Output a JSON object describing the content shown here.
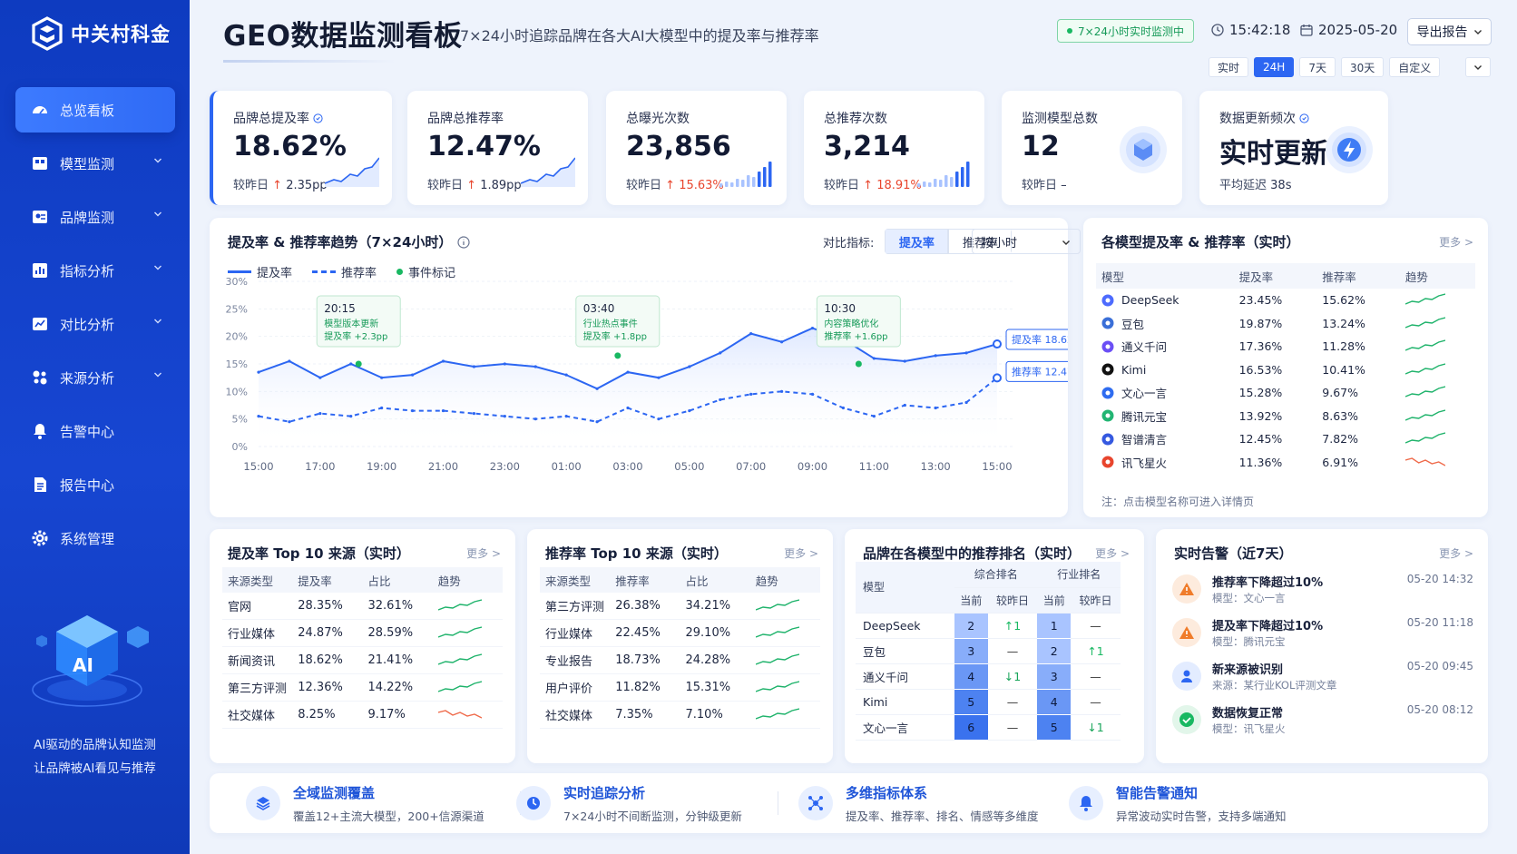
{
  "brand": {
    "name": "中关村科金"
  },
  "sidebar": {
    "items": [
      {
        "label": "总览看板",
        "icon": "dashboard-icon",
        "active": true,
        "expandable": false
      },
      {
        "label": "模型监测",
        "icon": "model-icon",
        "expandable": true
      },
      {
        "label": "品牌监测",
        "icon": "brand-icon",
        "expandable": true
      },
      {
        "label": "指标分析",
        "icon": "chart-icon",
        "expandable": true
      },
      {
        "label": "对比分析",
        "icon": "compare-icon",
        "expandable": true
      },
      {
        "label": "来源分析",
        "icon": "source-icon",
        "expandable": true
      },
      {
        "label": "告警中心",
        "icon": "bell-icon",
        "expandable": false
      },
      {
        "label": "报告中心",
        "icon": "report-icon",
        "expandable": false
      },
      {
        "label": "系统管理",
        "icon": "gear-icon",
        "expandable": false
      }
    ],
    "caption_line1": "AI驱动的品牌认知监测",
    "caption_line2": "让品牌被AI看见与推荐"
  },
  "header": {
    "title": "GEO数据监测看板",
    "subtitle": "7×24小时追踪品牌在各大AI大模型中的提及率与推荐率",
    "live_badge": "7×24小时实时监测中",
    "time": "15:42:18",
    "date": "2025-05-20",
    "export_label": "导出报告",
    "ranges": [
      "实时",
      "24H",
      "7天",
      "30天",
      "自定义"
    ],
    "active_range": "24H"
  },
  "kpis": [
    {
      "label": "品牌总提及率",
      "value": "18.62%",
      "cmp_label": "较昨日",
      "change": "2.35pp",
      "dir": "up",
      "has_info": true
    },
    {
      "label": "品牌总推荐率",
      "value": "12.47%",
      "cmp_label": "较昨日",
      "change": "1.89pp",
      "dir": "up"
    },
    {
      "label": "总曝光次数",
      "value": "23,856",
      "cmp_label": "较昨日",
      "change": "15.63%",
      "dir": "up"
    },
    {
      "label": "总推荐次数",
      "value": "3,214",
      "cmp_label": "较昨日",
      "change": "18.91%",
      "dir": "up"
    },
    {
      "label": "监测模型总数",
      "value": "12",
      "cmp_label": "较昨日",
      "change": "–",
      "dir": "flat"
    },
    {
      "label": "数据更新频次",
      "value": "实时更新",
      "cmp_label": "平均延迟",
      "change": "38s",
      "dir": "none",
      "has_info": true
    }
  ],
  "trend": {
    "title": "提及率 & 推荐率趋势（7×24小时）",
    "compare_label": "对比指标:",
    "compare_options": [
      "提及率",
      "推荐率"
    ],
    "granularity": "按小时",
    "legend": [
      "提及率",
      "推荐率",
      "事件标记"
    ],
    "annotations": [
      {
        "time": "20:15",
        "line1": "模型版本更新",
        "line2": "提及率 +2.3pp"
      },
      {
        "time": "03:40",
        "line1": "行业热点事件",
        "line2": "提及率 +1.8pp"
      },
      {
        "time": "10:30",
        "line1": "内容策略优化",
        "line2": "推荐率 +1.6pp"
      }
    ],
    "end_labels": [
      "提及率 18.62%",
      "推荐率 12.47%"
    ]
  },
  "chart_data": {
    "type": "line",
    "x": [
      "15:00",
      "16:00",
      "17:00",
      "18:00",
      "19:00",
      "20:00",
      "21:00",
      "22:00",
      "23:00",
      "00:00",
      "01:00",
      "02:00",
      "03:00",
      "04:00",
      "05:00",
      "06:00",
      "07:00",
      "08:00",
      "09:00",
      "10:00",
      "11:00",
      "12:00",
      "13:00",
      "14:00",
      "15:00"
    ],
    "x_ticks": [
      "15:00",
      "17:00",
      "19:00",
      "21:00",
      "23:00",
      "01:00",
      "03:00",
      "05:00",
      "07:00",
      "09:00",
      "11:00",
      "13:00",
      "15:00"
    ],
    "ylim": [
      0,
      30
    ],
    "y_ticks": [
      "0%",
      "5%",
      "10%",
      "15%",
      "20%",
      "25%",
      "30%"
    ],
    "series": [
      {
        "name": "提及率",
        "style": "solid",
        "color": "#2c66f2",
        "values": [
          13.5,
          15.5,
          12.5,
          15.0,
          12.5,
          13.0,
          15.5,
          14.5,
          15.0,
          14.5,
          13.0,
          10.5,
          13.5,
          12.5,
          14.5,
          17.0,
          20.5,
          19.0,
          21.5,
          19.5,
          16.0,
          15.5,
          16.5,
          17.0,
          18.62
        ]
      },
      {
        "name": "推荐率",
        "style": "dashed",
        "color": "#2c66f2",
        "values": [
          5.5,
          4.5,
          6.0,
          5.5,
          7.0,
          6.5,
          6.5,
          6.0,
          5.5,
          5.0,
          5.5,
          4.5,
          7.0,
          5.0,
          6.5,
          8.5,
          9.5,
          10.0,
          9.5,
          7.0,
          5.5,
          7.5,
          7.0,
          8.0,
          12.47
        ]
      }
    ],
    "events": [
      {
        "x": "20:15",
        "y": 15.0
      },
      {
        "x": "03:40",
        "y": 16.5
      },
      {
        "x": "10:30",
        "y": 15.0
      }
    ]
  },
  "model_table": {
    "title": "各模型提及率 & 推荐率（实时）",
    "more": "更多 >",
    "headers": [
      "模型",
      "提及率",
      "推荐率",
      "趋势"
    ],
    "rows": [
      {
        "name": "DeepSeek",
        "mention": "23.45%",
        "recommend": "15.62%",
        "color": "#4d6bfe",
        "trend": "up"
      },
      {
        "name": "豆包",
        "mention": "19.87%",
        "recommend": "13.24%",
        "color": "#3a6fd8",
        "trend": "up"
      },
      {
        "name": "通义千问",
        "mention": "17.36%",
        "recommend": "11.28%",
        "color": "#6b4ff5",
        "trend": "up"
      },
      {
        "name": "Kimi",
        "mention": "16.53%",
        "recommend": "10.41%",
        "color": "#111111",
        "trend": "up"
      },
      {
        "name": "文心一言",
        "mention": "15.28%",
        "recommend": "9.67%",
        "color": "#2f6cf0",
        "trend": "up"
      },
      {
        "name": "腾讯元宝",
        "mention": "13.92%",
        "recommend": "8.63%",
        "color": "#22b573",
        "trend": "up"
      },
      {
        "name": "智谱清言",
        "mention": "12.45%",
        "recommend": "7.82%",
        "color": "#3559e0",
        "trend": "up"
      },
      {
        "name": "讯飞星火",
        "mention": "11.36%",
        "recommend": "6.91%",
        "color": "#e8452d",
        "trend": "down"
      }
    ],
    "note": "注：点击模型名称可进入详情页"
  },
  "mention_sources": {
    "title": "提及率 Top 10 来源（实时）",
    "more": "更多 >",
    "headers": [
      "来源类型",
      "提及率",
      "占比",
      "趋势"
    ],
    "rows": [
      {
        "type": "官网",
        "rate": "28.35%",
        "share": "32.61%",
        "trend": "up"
      },
      {
        "type": "行业媒体",
        "rate": "24.87%",
        "share": "28.59%",
        "trend": "up"
      },
      {
        "type": "新闻资讯",
        "rate": "18.62%",
        "share": "21.41%",
        "trend": "up"
      },
      {
        "type": "第三方评测",
        "rate": "12.36%",
        "share": "14.22%",
        "trend": "up"
      },
      {
        "type": "社交媒体",
        "rate": "8.25%",
        "share": "9.17%",
        "trend": "down"
      }
    ]
  },
  "recommend_sources": {
    "title": "推荐率 Top 10 来源（实时）",
    "more": "更多 >",
    "headers": [
      "来源类型",
      "推荐率",
      "占比",
      "趋势"
    ],
    "rows": [
      {
        "type": "第三方评测",
        "rate": "26.38%",
        "share": "34.21%",
        "trend": "up"
      },
      {
        "type": "行业媒体",
        "rate": "22.45%",
        "share": "29.10%",
        "trend": "up"
      },
      {
        "type": "专业报告",
        "rate": "18.73%",
        "share": "24.28%",
        "trend": "up"
      },
      {
        "type": "用户评价",
        "rate": "11.82%",
        "share": "15.31%",
        "trend": "up"
      },
      {
        "type": "社交媒体",
        "rate": "7.35%",
        "share": "7.10%",
        "trend": "up"
      }
    ]
  },
  "rank": {
    "title": "品牌在各模型中的推荐排名（实时）",
    "more": "更多 >",
    "col_model": "模型",
    "group1": "综合排名",
    "group2": "行业排名",
    "sub_current": "当前",
    "sub_prev": "较昨日",
    "rows": [
      {
        "model": "DeepSeek",
        "overall": "2",
        "overall_chg": "↑1",
        "overall_dir": "up",
        "industry": "1",
        "industry_chg": "—",
        "industry_dir": "flat"
      },
      {
        "model": "豆包",
        "overall": "3",
        "overall_chg": "—",
        "overall_dir": "flat",
        "industry": "2",
        "industry_chg": "↑1",
        "industry_dir": "up"
      },
      {
        "model": "通义千问",
        "overall": "4",
        "overall_chg": "↓1",
        "overall_dir": "down",
        "industry": "3",
        "industry_chg": "—",
        "industry_dir": "flat"
      },
      {
        "model": "Kimi",
        "overall": "5",
        "overall_chg": "—",
        "overall_dir": "flat",
        "industry": "4",
        "industry_chg": "—",
        "industry_dir": "flat"
      },
      {
        "model": "文心一言",
        "overall": "6",
        "overall_chg": "—",
        "overall_dir": "flat",
        "industry": "5",
        "industry_chg": "↓1",
        "industry_dir": "down"
      }
    ]
  },
  "alerts": {
    "title": "实时告警（近7天）",
    "more": "更多 >",
    "items": [
      {
        "title": "推荐率下降超过10%",
        "sub": "模型：文心一言",
        "time": "05-20 14:32",
        "kind": "warning",
        "color": "#f07c2a"
      },
      {
        "title": "提及率下降超过10%",
        "sub": "模型：腾讯元宝",
        "time": "05-20 11:18",
        "kind": "warning",
        "color": "#f07c2a"
      },
      {
        "title": "新来源被识别",
        "sub": "来源：某行业KOL评测文章",
        "time": "05-20 09:45",
        "kind": "user",
        "color": "#2c66f2"
      },
      {
        "title": "数据恢复正常",
        "sub": "模型：讯飞星火",
        "time": "05-20 08:12",
        "kind": "ok",
        "color": "#19b862"
      }
    ]
  },
  "features": [
    {
      "title": "全域监测覆盖",
      "desc": "覆盖12+主流大模型，200+信源渠道",
      "icon": "layers-icon"
    },
    {
      "title": "实时追踪分析",
      "desc": "7×24小时不间断监测，分钟级更新",
      "icon": "tracking-icon"
    },
    {
      "title": "多维指标体系",
      "desc": "提及率、推荐率、排名、情感等多维度",
      "icon": "metrics-icon"
    },
    {
      "title": "智能告警通知",
      "desc": "异常波动实时告警，支持多端通知",
      "icon": "bell-icon"
    }
  ]
}
